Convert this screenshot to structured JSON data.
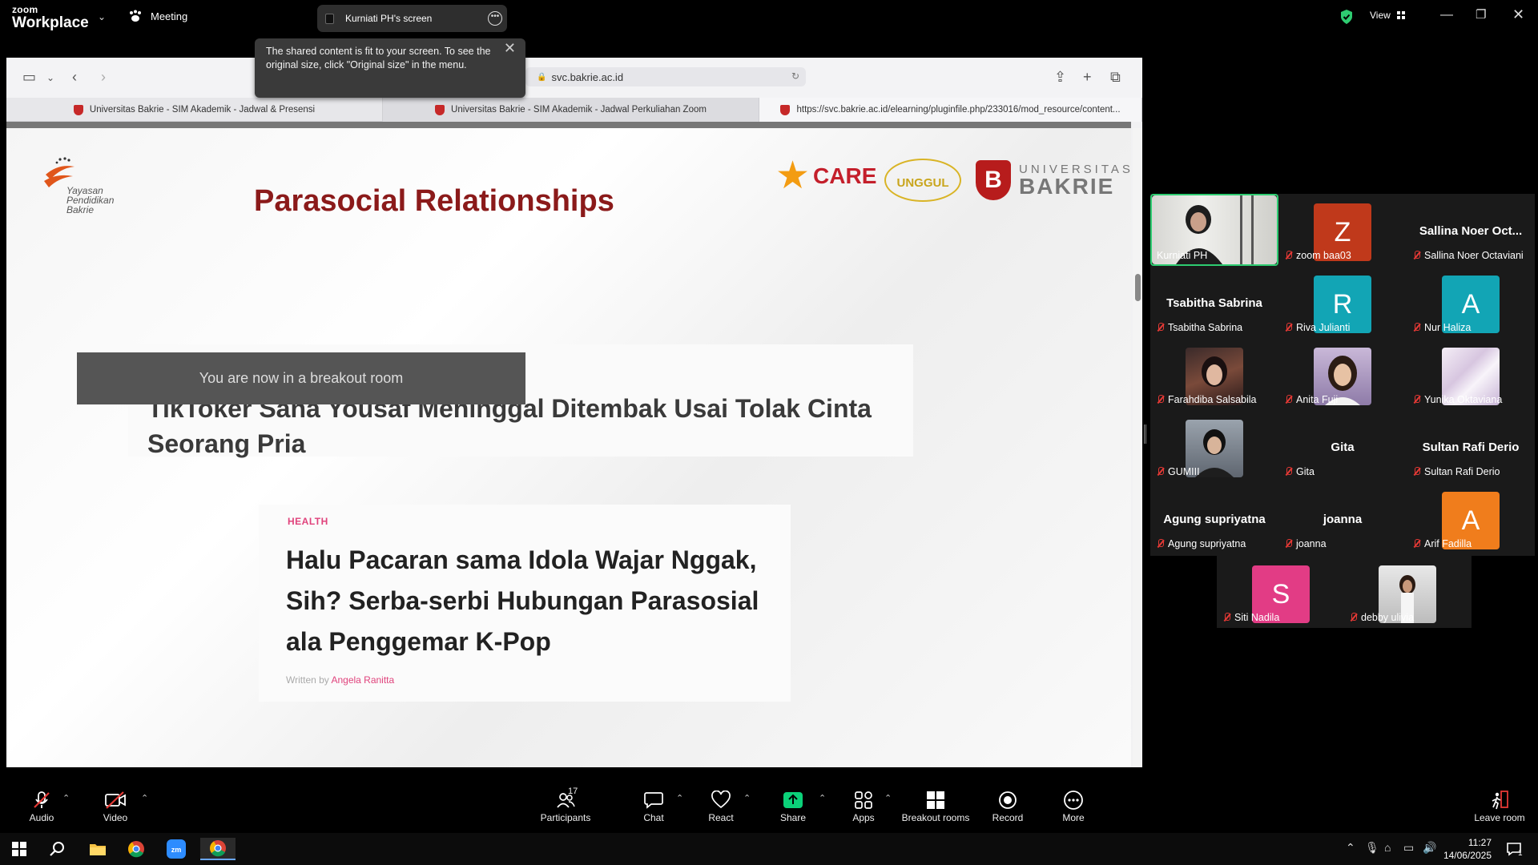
{
  "app": {
    "logo_line1": "zoom",
    "logo_line2": "Workplace",
    "meeting_label": "Meeting",
    "screen_share_label": "Kurniati PH's screen",
    "view_label": "View"
  },
  "tooltip": {
    "text": "The shared content is fit to your screen. To see the original size, click \"Original size\" in the menu."
  },
  "browser": {
    "url": "svc.bakrie.ac.id",
    "tabs": [
      {
        "label": "Universitas Bakrie - SIM Akademik - Jadwal & Presensi"
      },
      {
        "label": "Universitas Bakrie - SIM Akademik - Jadwal Perkuliahan Zoom"
      },
      {
        "label": "https://svc.bakrie.ac.id/elearning/pluginfile.php/233016/mod_resource/content..."
      }
    ]
  },
  "slide": {
    "foundation_logo": "Yayasan Pendidikan Bakrie",
    "title": "Parasocial Relationships",
    "care_logo": "CARE",
    "accreditation": "UNGGUL",
    "university_line1": "UNIVERSITAS",
    "university_line2": "BAKRIE",
    "breakout_notice": "You are now in a breakout room",
    "headline": "TikToker Sana Yousaf Meninggal Ditembak Usai Tolak Cinta Seorang Pria",
    "article_tag": "HEALTH",
    "article_title": "Halu Pacaran sama Idola Wajar Nggak, Sih? Serba-serbi Hubungan Parasosial ala Penggemar K-Pop",
    "byline_prefix": "Written by",
    "byline_author": "Angela Ranitta"
  },
  "participants": [
    {
      "label": "Kurniati PH",
      "type": "photo",
      "active": true
    },
    {
      "label": "zoom baa03",
      "type": "avatar",
      "initial": "Z",
      "color": "#c0391b"
    },
    {
      "label": "Sallina Noer Octaviani",
      "type": "name",
      "display_name": "Sallina Noer Oct..."
    },
    {
      "label": "Tsabitha Sabrina",
      "type": "name",
      "display_name": "Tsabitha Sabrina"
    },
    {
      "label": "Riva Julianti",
      "type": "avatar",
      "initial": "R",
      "color": "#12a5b5"
    },
    {
      "label": "Nur Haliza",
      "type": "avatar",
      "initial": "A",
      "color": "#12a5b5"
    },
    {
      "label": "Farahdiba Salsabila",
      "type": "photo"
    },
    {
      "label": "Anita Fuji",
      "type": "photo"
    },
    {
      "label": "Yunika Oktaviana",
      "type": "photo"
    },
    {
      "label": "GUMIII",
      "type": "photo"
    },
    {
      "label": "Gita",
      "type": "name",
      "display_name": "Gita"
    },
    {
      "label": "Sultan Rafi Derio",
      "type": "name",
      "display_name": "Sultan Rafi Derio"
    },
    {
      "label": "Agung supriyatna",
      "type": "name",
      "display_name": "Agung supriyatna"
    },
    {
      "label": "joanna",
      "type": "name",
      "display_name": "joanna"
    },
    {
      "label": "Arif Fadilla",
      "type": "avatar",
      "initial": "A",
      "color": "#f07d1c"
    },
    {
      "label": "Siti Nadila",
      "type": "avatar",
      "initial": "S",
      "color": "#e23c85"
    },
    {
      "label": "debby ulivia",
      "type": "photo"
    }
  ],
  "toolbar": {
    "audio": "Audio",
    "video": "Video",
    "participants": "Participants",
    "participants_count": "17",
    "chat": "Chat",
    "react": "React",
    "share": "Share",
    "apps": "Apps",
    "breakout_rooms": "Breakout rooms",
    "record": "Record",
    "more": "More",
    "leave": "Leave room"
  },
  "taskbar": {
    "time": "11:27",
    "date": "14/06/2025",
    "notification_count": "1"
  },
  "colors": {
    "active_speaker": "#2ecc71",
    "share_green": "#0bd179",
    "muted_red": "#e53935"
  }
}
